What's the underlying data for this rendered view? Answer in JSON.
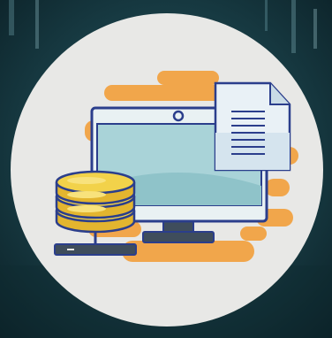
{
  "illustration": {
    "subject": "computer-server-document-icon",
    "elements": [
      "monitor-icon",
      "database-server-icon",
      "document-icon",
      "orange-cloud-shape"
    ]
  },
  "colors": {
    "background_dark": "#0f2b33",
    "background_mid": "#1f4a55",
    "circle": "#e8e8e6",
    "orange": "#f1a64b",
    "outline": "#2b3e8c",
    "screen": "#a9d3d8",
    "screen_shade": "#8fc3c9",
    "monitor_frame": "#e9f1f3",
    "stand": "#3f4d5c",
    "coin_yellow": "#f2d24a",
    "coin_dark": "#e3b52f",
    "paper": "#e9f1f6",
    "paper_fold": "#c9dbe6"
  }
}
